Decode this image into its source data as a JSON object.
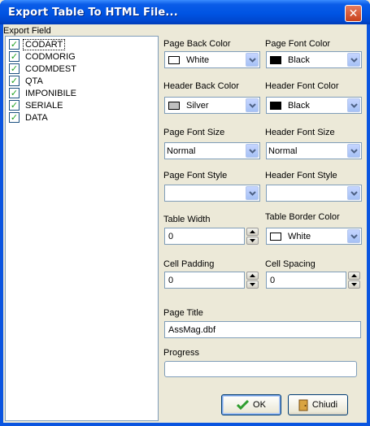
{
  "window": {
    "title": "Export Table To HTML File...",
    "close_glyph": "✕"
  },
  "fields": {
    "caption": "Export Field",
    "items": [
      {
        "label": "CODART",
        "checked": true
      },
      {
        "label": "CODMORIG",
        "checked": true
      },
      {
        "label": "CODMDEST",
        "checked": true
      },
      {
        "label": "QTA",
        "checked": true
      },
      {
        "label": "IMPONIBILE",
        "checked": true
      },
      {
        "label": "SERIALE",
        "checked": true
      },
      {
        "label": "DATA",
        "checked": true
      }
    ]
  },
  "options": {
    "page_back_color": {
      "label": "Page Back Color",
      "value": "White",
      "swatch": "#ffffff"
    },
    "page_font_color": {
      "label": "Page Font Color",
      "value": "Black",
      "swatch": "#000000"
    },
    "header_back_color": {
      "label": "Header Back Color",
      "value": "Silver",
      "swatch": "#c0c0c0"
    },
    "header_font_color": {
      "label": "Header Font Color",
      "value": "Black",
      "swatch": "#000000"
    },
    "page_font_size": {
      "label": "Page Font Size",
      "value": "Normal"
    },
    "header_font_size": {
      "label": "Header Font Size",
      "value": "Normal"
    },
    "page_font_style": {
      "label": "Page Font Style",
      "value": ""
    },
    "header_font_style": {
      "label": "Header Font Style",
      "value": ""
    },
    "table_width": {
      "label": "Table Width",
      "value": "0"
    },
    "table_border_color": {
      "label": "Table Border Color",
      "value": "White",
      "swatch": "#ffffff"
    },
    "cell_padding": {
      "label": "Cell Padding",
      "value": "0"
    },
    "cell_spacing": {
      "label": "Cell Spacing",
      "value": "0"
    },
    "page_title": {
      "label": "Page Title",
      "value": "AssMag.dbf"
    },
    "progress": {
      "label": "Progress",
      "value": 0
    }
  },
  "buttons": {
    "ok": "OK",
    "close": "Chiudi"
  },
  "colors": {
    "title_bar": "#0054e3",
    "dialog_bg": "#ece9d8",
    "check": "#21a121"
  }
}
